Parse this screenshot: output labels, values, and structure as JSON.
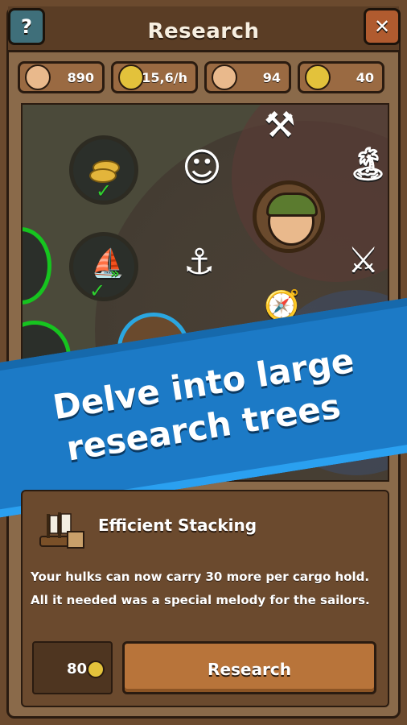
{
  "header": {
    "title": "Research",
    "help_label": "?",
    "close_label": "✕"
  },
  "stats": [
    {
      "icon": "pirate-head-icon",
      "value": "890",
      "color": "#e9b98c"
    },
    {
      "icon": "lightbulb-plus-icon",
      "value": "15,6/h",
      "color": "#e3c23b"
    },
    {
      "icon": "pirate-lightbulb-icon",
      "value": "94",
      "color": "#e9b98c"
    },
    {
      "icon": "lightbulb-upgrade-icon",
      "value": "40",
      "color": "#e3c23b"
    }
  ],
  "tree": {
    "icons": [
      "hammer-icon",
      "island-icon",
      "smiley-icon",
      "anchor-icon",
      "crossed-swords-icon",
      "compass-icon",
      "coins-icon",
      "ship-icon"
    ],
    "glyphs": {
      "hammer": "⚒",
      "island": "🏝",
      "smiley": "☺",
      "anchor": "⚓",
      "swords": "⚔",
      "compass": "🧭",
      "check": "✓",
      "arrows": "»"
    }
  },
  "banner": {
    "line1": "Delve into large",
    "line2": "research trees"
  },
  "detail": {
    "title": "Efficient Stacking",
    "description": "Your hulks can now carry 30 more per cargo hold. All it needed was a special melody for the sailors.",
    "cost": "80",
    "button_label": "Research"
  },
  "colors": {
    "banner": "#1c7ac6",
    "available": "#16c41f",
    "selected": "#2aa6e0",
    "button": "#b8743a"
  }
}
